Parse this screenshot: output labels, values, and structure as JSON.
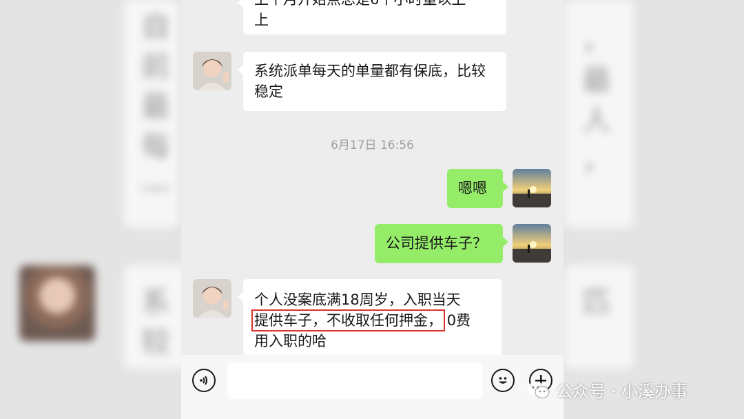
{
  "messages": [
    {
      "side": "in",
      "lines": [
        "上个月开始点总是6个小时量以上",
        "上"
      ]
    },
    {
      "side": "in",
      "text": "系统派单每天的单量都有保底，比较稳定"
    },
    {
      "timestamp": "6月17日 16:56"
    },
    {
      "side": "out",
      "text": "嗯嗯"
    },
    {
      "side": "out",
      "text": "公司提供车子？"
    },
    {
      "side": "in",
      "line1": "个人没案底满18周岁，入职当天",
      "highlight": "提供车子，不收取任何押金，",
      "rest": "0费",
      "line3": "用入职的哈"
    }
  ],
  "input": {
    "placeholder": ""
  },
  "icons": {
    "voice": "voice-icon",
    "emoji": "emoji-icon",
    "plus": "plus-icon"
  },
  "watermark": {
    "text": "公众号 · 小溪办事"
  },
  "background_blur": {
    "left_lines": [
      "自",
      "前",
      "最",
      "每",
      "—",
      "上"
    ],
    "right_lines": [
      "，",
      "最",
      "人",
      "，",
      "价"
    ],
    "left_lower": [
      "系",
      "较"
    ],
    "right_lower": [
      "匹"
    ]
  },
  "colors": {
    "out_bubble": "#95ec69",
    "in_bubble": "#ffffff",
    "chat_bg": "#ededed",
    "highlight_box": "#d9332b"
  }
}
